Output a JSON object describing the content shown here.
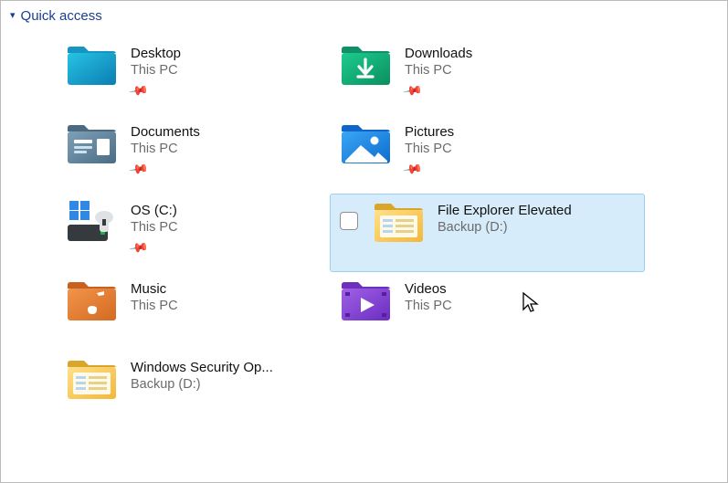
{
  "section": {
    "title": "Quick access"
  },
  "items": [
    {
      "name": "Desktop",
      "location": "This PC",
      "pinned": true,
      "icon": "desktop",
      "hovered": false
    },
    {
      "name": "Downloads",
      "location": "This PC",
      "pinned": true,
      "icon": "downloads",
      "hovered": false
    },
    {
      "name": "Documents",
      "location": "This PC",
      "pinned": true,
      "icon": "documents",
      "hovered": false
    },
    {
      "name": "Pictures",
      "location": "This PC",
      "pinned": true,
      "icon": "pictures",
      "hovered": false
    },
    {
      "name": "OS (C:)",
      "location": "This PC",
      "pinned": true,
      "icon": "drive-c",
      "hovered": false
    },
    {
      "name": "File Explorer Elevated",
      "location": "Backup (D:)",
      "pinned": false,
      "icon": "folder",
      "hovered": true
    },
    {
      "name": "Music",
      "location": "This PC",
      "pinned": false,
      "icon": "music",
      "hovered": false
    },
    {
      "name": "Videos",
      "location": "This PC",
      "pinned": false,
      "icon": "videos",
      "hovered": false
    },
    {
      "name": "Windows Security Op...",
      "location": "Backup (D:)",
      "pinned": false,
      "icon": "folder",
      "hovered": false
    }
  ]
}
